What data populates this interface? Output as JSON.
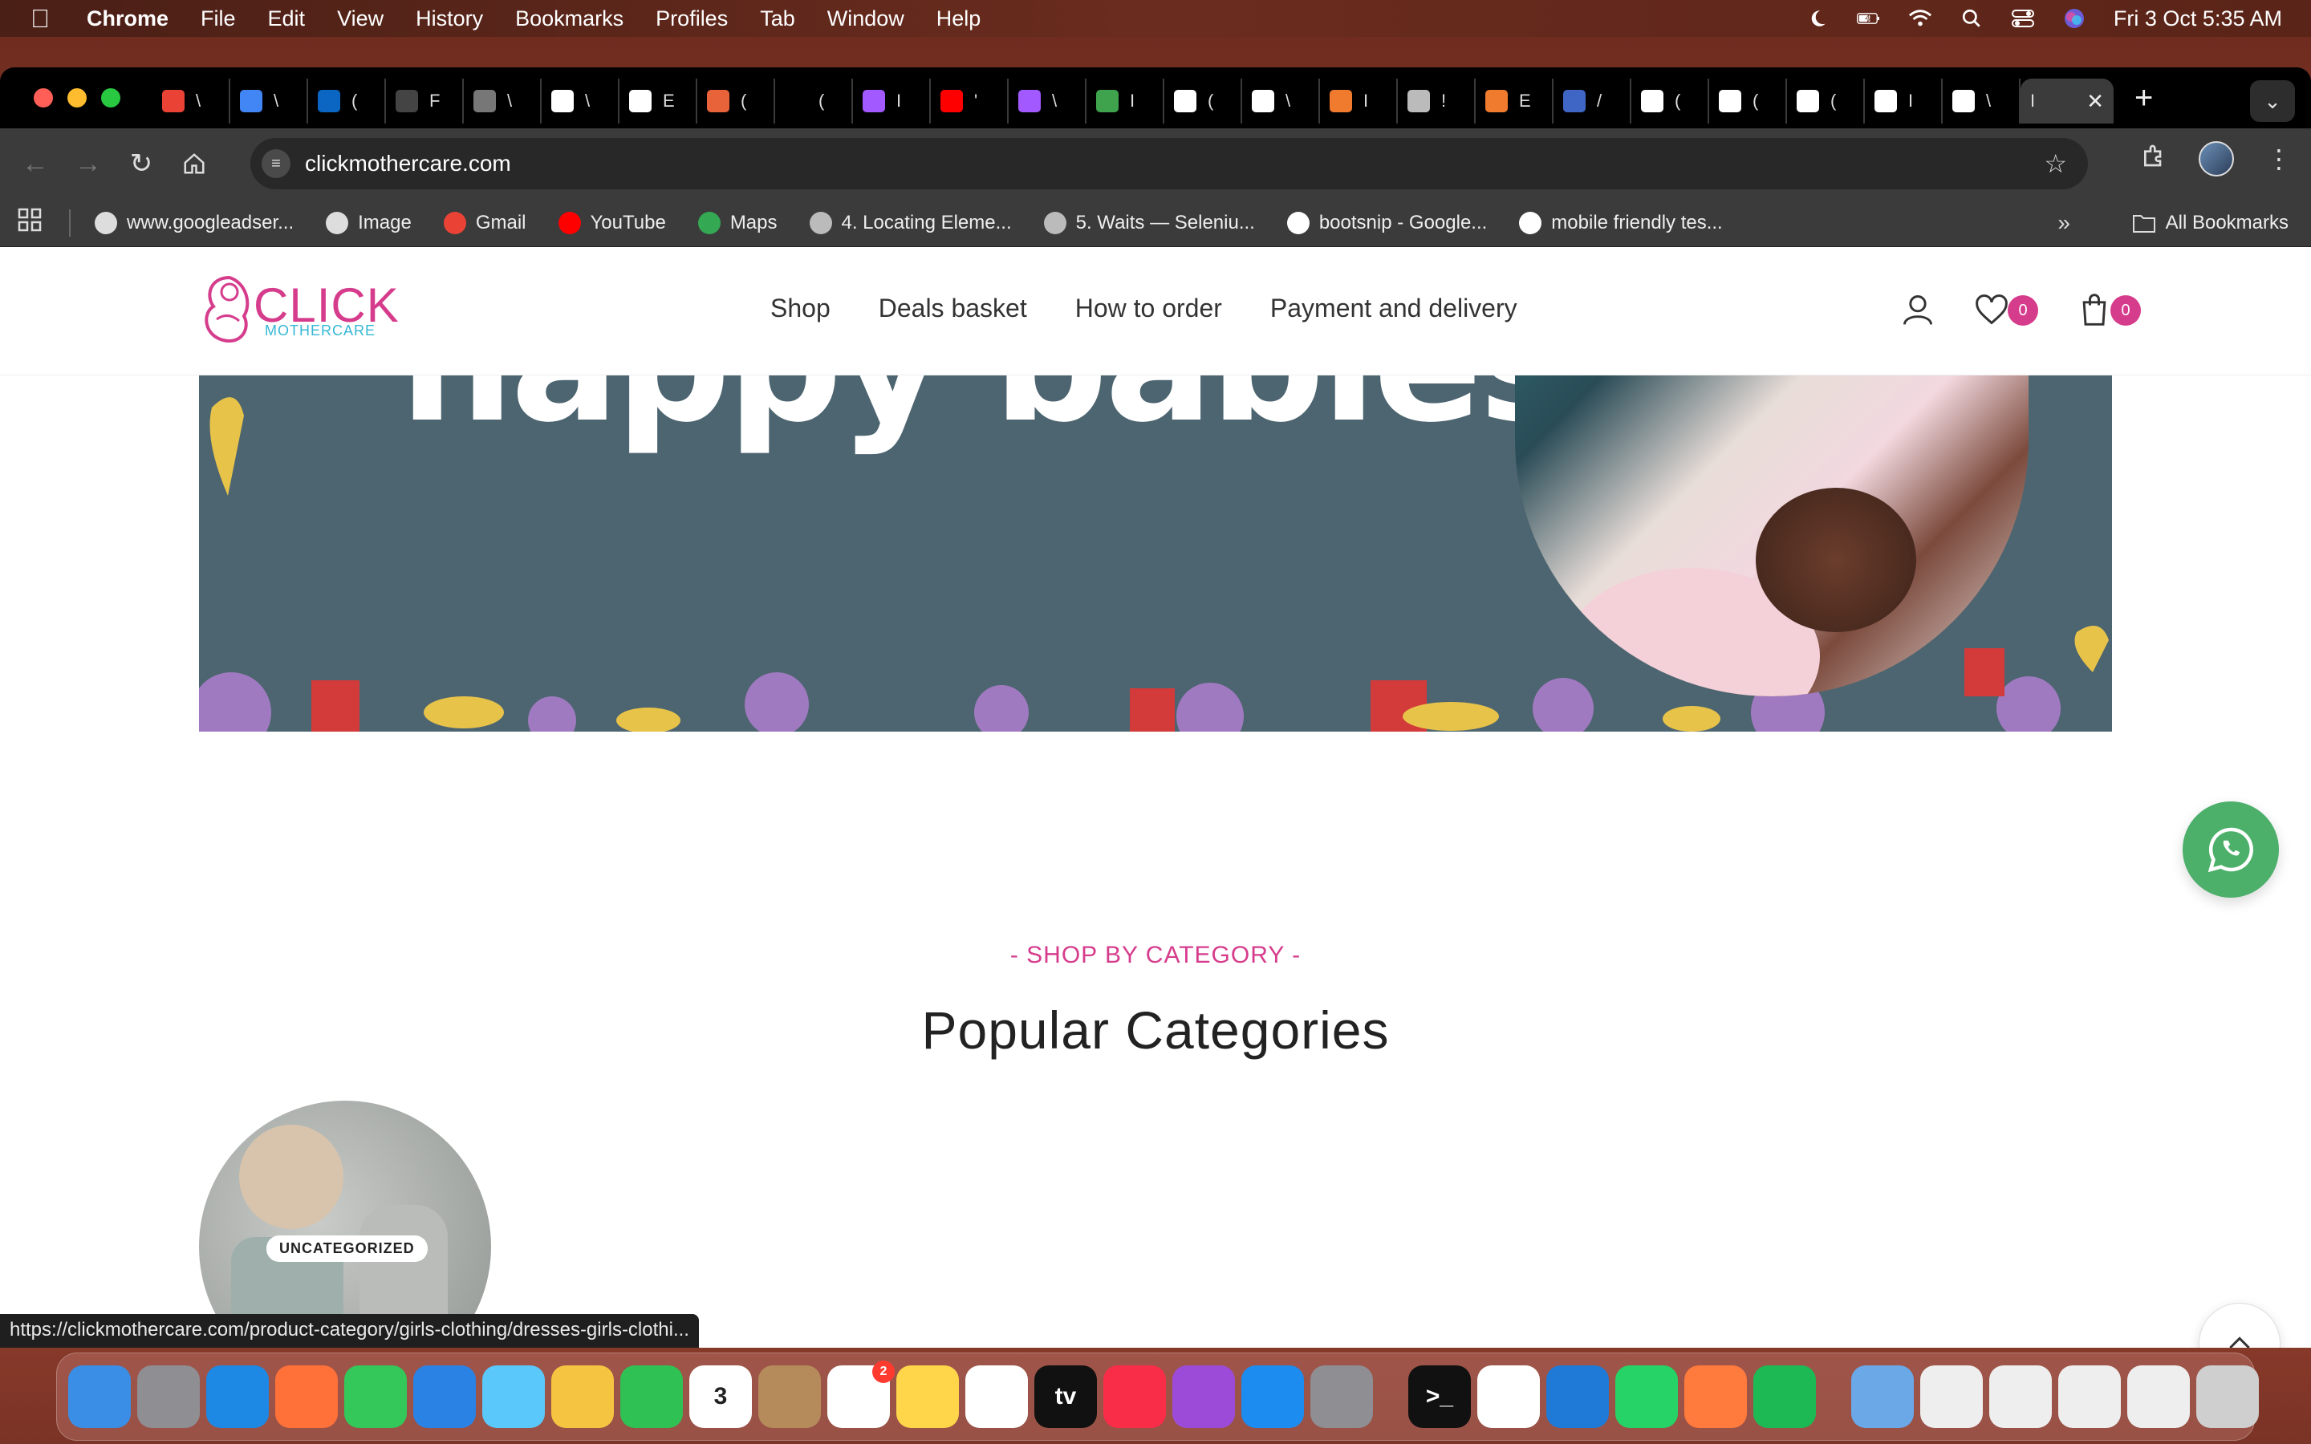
{
  "menubar": {
    "app": "Chrome",
    "items": [
      "File",
      "Edit",
      "View",
      "History",
      "Bookmarks",
      "Profiles",
      "Tab",
      "Window",
      "Help"
    ],
    "datetime": "Fri 3 Oct  5:35 AM"
  },
  "browser": {
    "tabs": [
      {
        "icon": "gmail-icon",
        "color": "#ea4335",
        "label": "\\"
      },
      {
        "icon": "docs-icon",
        "color": "#4285f4",
        "label": "\\"
      },
      {
        "icon": "linkedin-icon",
        "color": "#0a66c2",
        "label": "("
      },
      {
        "icon": "github-icon",
        "color": "#444444",
        "label": "F"
      },
      {
        "icon": "globe-icon",
        "color": "#777777",
        "label": "\\"
      },
      {
        "icon": "vercel-icon",
        "color": "#ffffff",
        "label": "\\"
      },
      {
        "icon": "vercel-icon",
        "color": "#ffffff",
        "label": "E"
      },
      {
        "icon": "app-icon",
        "color": "#e8623a",
        "label": "("
      },
      {
        "icon": "blank-icon",
        "color": "#000000",
        "label": "("
      },
      {
        "icon": "figma-icon",
        "color": "#a259ff",
        "label": "I"
      },
      {
        "icon": "youtube-icon",
        "color": "#ff0000",
        "label": "'"
      },
      {
        "icon": "figma-icon",
        "color": "#a259ff",
        "label": "\\"
      },
      {
        "icon": "app-icon",
        "color": "#3fa34d",
        "label": "I"
      },
      {
        "icon": "google-icon",
        "color": "#ffffff",
        "label": "("
      },
      {
        "icon": "vercel-icon",
        "color": "#ffffff",
        "label": "\\"
      },
      {
        "icon": "app-icon",
        "color": "#f07b2e",
        "label": "I"
      },
      {
        "icon": "book-icon",
        "color": "#bbbbbb",
        "label": "!"
      },
      {
        "icon": "app-icon",
        "color": "#f07b2e",
        "label": "E"
      },
      {
        "icon": "app-icon",
        "color": "#3f66c4",
        "label": "/"
      },
      {
        "icon": "google-icon",
        "color": "#ffffff",
        "label": "("
      },
      {
        "icon": "vercel-icon",
        "color": "#ffffff",
        "label": "("
      },
      {
        "icon": "vercel-icon",
        "color": "#ffffff",
        "label": "("
      },
      {
        "icon": "vercel-icon",
        "color": "#ffffff",
        "label": "I"
      },
      {
        "icon": "google-icon",
        "color": "#ffffff",
        "label": "\\"
      },
      {
        "icon": "active-tab",
        "color": "#3b3b3b",
        "label": "I"
      }
    ],
    "url": "clickmothercare.com",
    "bookmarks": [
      {
        "label": "www.googleadser...",
        "icon": "globe-icon",
        "color": "#dddddd"
      },
      {
        "label": "Image",
        "icon": "globe-icon",
        "color": "#dddddd"
      },
      {
        "label": "Gmail",
        "icon": "gmail-icon",
        "color": "#ea4335"
      },
      {
        "label": "YouTube",
        "icon": "youtube-icon",
        "color": "#ff0000"
      },
      {
        "label": "Maps",
        "icon": "maps-icon",
        "color": "#34a853"
      },
      {
        "label": "4. Locating Eleme...",
        "icon": "book-icon",
        "color": "#bbbbbb"
      },
      {
        "label": "5. Waits — Seleniu...",
        "icon": "book-icon",
        "color": "#bbbbbb"
      },
      {
        "label": "bootsnip - Google...",
        "icon": "google-icon",
        "color": "#ffffff"
      },
      {
        "label": "mobile friendly tes...",
        "icon": "google-icon",
        "color": "#ffffff"
      }
    ],
    "all_bookmarks": "All Bookmarks",
    "status_url": "https://clickmothercare.com/product-category/girls-clothing/dresses-girls-clothi..."
  },
  "site": {
    "logo_main": "CLICK",
    "logo_sub": "MOTHERCARE",
    "nav": [
      "Shop",
      "Deals basket",
      "How to order",
      "Payment and delivery"
    ],
    "wishlist_count": "0",
    "cart_count": "0",
    "hero_text": "happy babies",
    "section_subtitle": "- SHOP BY CATEGORY -",
    "section_title": "Popular Categories",
    "categories": [
      {
        "label": "UNCATEGORIZED"
      }
    ]
  },
  "colors": {
    "brand_pink": "#d63c8c",
    "brand_cyan": "#35b7d6",
    "whatsapp_green": "#4caf6a",
    "hero_bg": "#4d6570"
  },
  "dock": {
    "apps": [
      {
        "name": "finder-icon",
        "color": "#3a8ee6"
      },
      {
        "name": "launchpad-icon",
        "color": "#8e8e93"
      },
      {
        "name": "safari-icon",
        "color": "#1e88e5"
      },
      {
        "name": "firefox-icon",
        "color": "#ff7139"
      },
      {
        "name": "messages-icon",
        "color": "#34c759"
      },
      {
        "name": "mail-icon",
        "color": "#2a82e4"
      },
      {
        "name": "maps-icon",
        "color": "#5ac8fa"
      },
      {
        "name": "photos-icon",
        "color": "#f5c542"
      },
      {
        "name": "facetime-icon",
        "color": "#30c155"
      },
      {
        "name": "calendar-icon",
        "color": "#ffffff",
        "text": "3"
      },
      {
        "name": "contacts-icon",
        "color": "#b68b5c"
      },
      {
        "name": "reminders-icon",
        "color": "#ffffff",
        "badge": "2"
      },
      {
        "name": "notes-icon",
        "color": "#ffd54a"
      },
      {
        "name": "freeform-icon",
        "color": "#ffffff"
      },
      {
        "name": "appletv-icon",
        "color": "#111111",
        "text": "tv"
      },
      {
        "name": "music-icon",
        "color": "#fa2d48"
      },
      {
        "name": "podcasts-icon",
        "color": "#9b4bd8"
      },
      {
        "name": "appstore-icon",
        "color": "#1c8cf0"
      },
      {
        "name": "settings-icon",
        "color": "#8e8e93"
      },
      {
        "name": "terminal-icon",
        "color": "#111111",
        "text": ">_"
      },
      {
        "name": "chrome-icon",
        "color": "#ffffff"
      },
      {
        "name": "vscode-icon",
        "color": "#1e7ad6"
      },
      {
        "name": "whatsapp-icon",
        "color": "#25d366"
      },
      {
        "name": "pen-icon",
        "color": "#ff7a3d"
      },
      {
        "name": "spotify-icon",
        "color": "#1db954"
      }
    ],
    "others": [
      {
        "name": "folder-icon",
        "color": "#6aa8e8"
      },
      {
        "name": "window-thumb-icon",
        "color": "#eeeeee"
      },
      {
        "name": "window-thumb-icon",
        "color": "#eeeeee"
      },
      {
        "name": "window-thumb-icon",
        "color": "#eeeeee"
      },
      {
        "name": "window-thumb-icon",
        "color": "#eeeeee"
      },
      {
        "name": "trash-icon",
        "color": "#cfcfcf"
      }
    ]
  }
}
